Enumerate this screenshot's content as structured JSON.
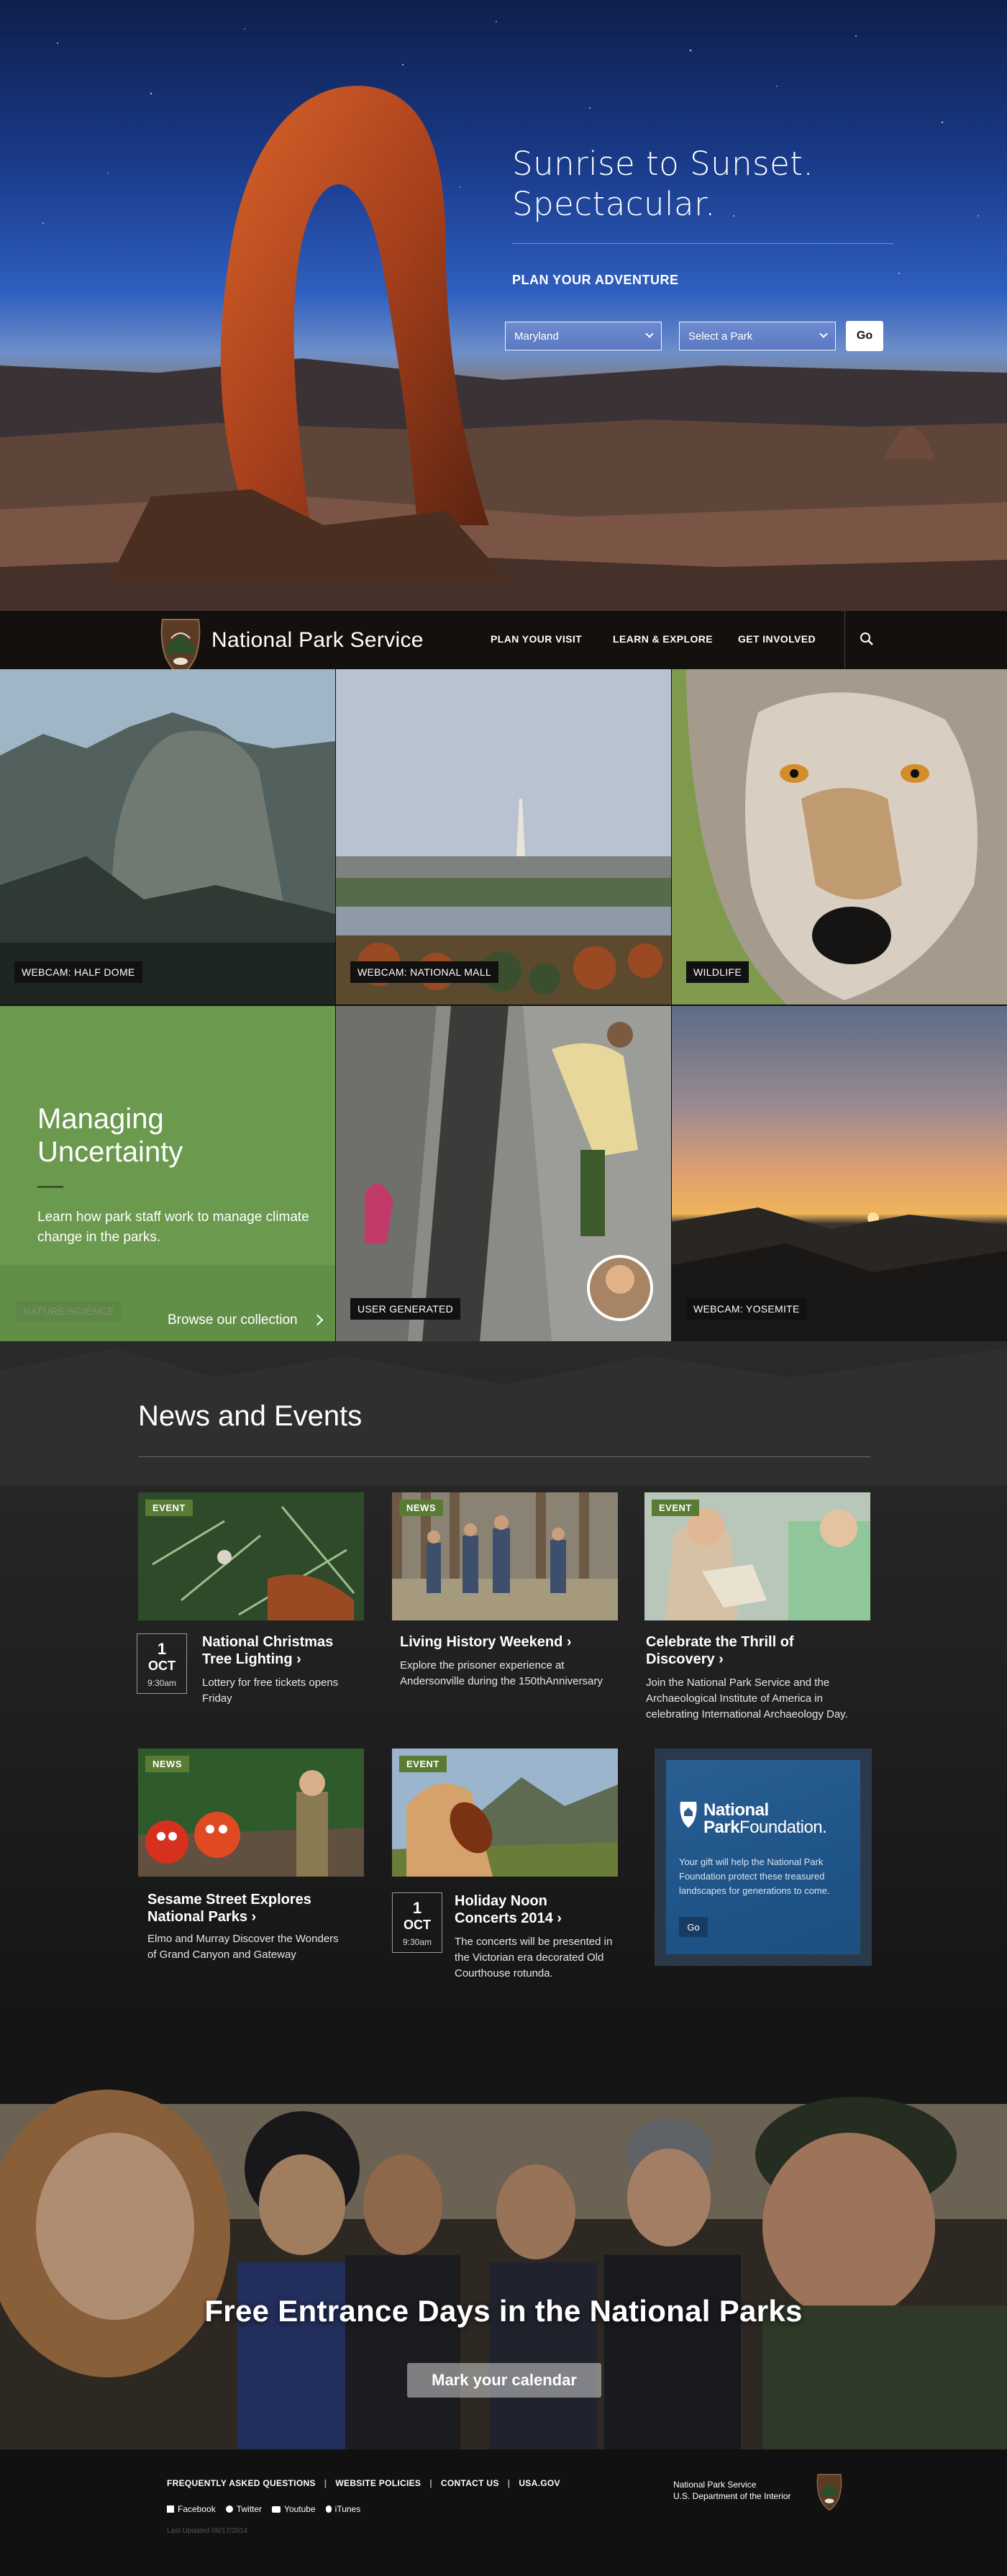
{
  "hero": {
    "title_line1": "Sunrise to Sunset.",
    "title_line2": "Spectacular.",
    "plan_heading": "PLAN YOUR ADVENTURE",
    "state_select_value": "Maryland",
    "park_select_value": "Select a Park",
    "go_label": "Go"
  },
  "nav": {
    "brand": "National Park Service",
    "items": [
      {
        "label": "PLAN YOUR VISIT"
      },
      {
        "label": "LEARN & EXPLORE"
      },
      {
        "label": "GET INVOLVED"
      }
    ],
    "search_icon": "search-icon"
  },
  "tiles": {
    "half_dome": "WEBCAM: HALF DOME",
    "national_mall": "WEBCAM: NATIONAL MALL",
    "wildlife": "WILDLIFE",
    "user_generated": "USER GENERATED",
    "yosemite": "WEBCAM: YOSEMITE"
  },
  "promo": {
    "title_line1": "Managing",
    "title_line2": "Uncertainty",
    "text": "Learn how park staff work to manage climate change in the parks.",
    "tag": "NATURE/SCIENCE",
    "link": "Browse our collection",
    "color": "#6a9a4c"
  },
  "news": {
    "title": "News and Events",
    "cards": [
      {
        "badge": "EVENT",
        "title": "National Christmas Tree Lighting ›",
        "text": "Lottery for free tickets opens Friday",
        "day": "1",
        "month": "OCT",
        "time": "9:30am"
      },
      {
        "badge": "NEWS",
        "title": "Living History Weekend ›",
        "text": "Explore the prisoner experience at Andersonville during the 150thAnniversary"
      },
      {
        "badge": "EVENT",
        "title": "Celebrate the Thrill of Discovery ›",
        "text": "Join the National Park Service and the Archaeological Institute of America in celebrating International Archaeology Day."
      },
      {
        "badge": "NEWS",
        "title": "Sesame Street Explores National Parks ›",
        "text": "Elmo and Murray Discover the Wonders of Grand Canyon and Gateway"
      },
      {
        "badge": "EVENT",
        "title": "Holiday Noon Concerts 2014 ›",
        "text": "The concerts will be presented in the Victorian era decorated Old Courthouse rotunda.",
        "day": "1",
        "month": "OCT",
        "time": "9:30am"
      }
    ],
    "foundation": {
      "name_line1": "National",
      "name_line2_bold": "Park",
      "name_line2_rest": "Foundation.",
      "text": "Your gift will help the National Park Foundation protect these treasured landscapes for generations to come.",
      "go_label": "Go"
    }
  },
  "banner": {
    "title": "Free Entrance Days in the National Parks",
    "button": "Mark your calendar"
  },
  "footer": {
    "links": [
      "FREQUENTLY ASKED QUESTIONS",
      "WEBSITE POLICIES",
      "CONTACT US",
      "USA.GOV"
    ],
    "social": [
      "Facebook",
      "Twitter",
      "Youtube",
      "iTunes"
    ],
    "updated": "Last Updated 08/17/2014",
    "org_line1": "National Park Service",
    "org_line2": "U.S. Department of the Interior"
  }
}
